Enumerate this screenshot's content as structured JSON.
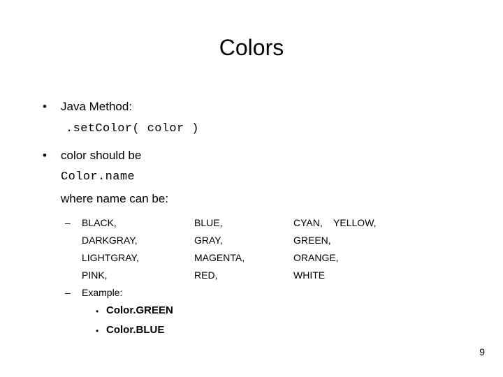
{
  "slide": {
    "title": "Colors",
    "page_number": "9",
    "background_color": "#ffffff",
    "text_color": "#000000"
  },
  "bullets": {
    "level1_glyph": "•",
    "level2_glyph": "–",
    "level3_glyph": "•"
  },
  "body": {
    "java_method_label": "Java Method:",
    "method_signature": ".setColor( color )",
    "color_should_be_label": "color should be",
    "color_name_code": "Color.name",
    "where_name_label": "where name can be:"
  },
  "color_list": {
    "columns": [
      [
        "BLACK,",
        "DARKGRAY,",
        "LIGHTGRAY,",
        "PINK,"
      ],
      [
        "BLUE,",
        "GRAY,",
        "MAGENTA,",
        "RED,"
      ],
      [
        "CYAN,    YELLOW,",
        "GREEN,",
        "ORANGE,",
        "WHITE"
      ]
    ]
  },
  "example": {
    "label": "Example:",
    "items": [
      "Color.GREEN",
      "Color.BLUE"
    ]
  }
}
